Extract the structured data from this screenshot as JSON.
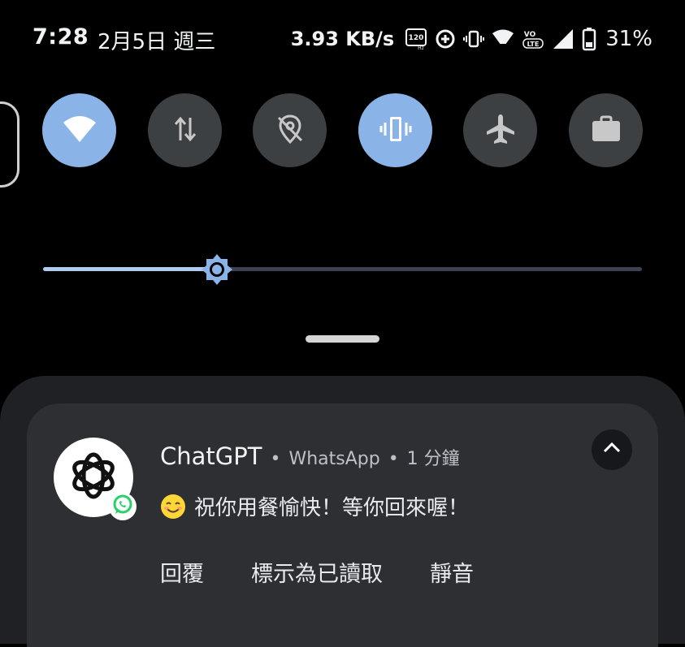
{
  "status_bar": {
    "time": "7:28",
    "date": "2月5日 週三",
    "network_speed": "3.93 KB/s",
    "battery_percent": "31%",
    "icons": [
      "120hz-icon",
      "data-saver-icon",
      "vibrate-icon",
      "wifi-signal-icon",
      "volte-icon",
      "cell-signal-icon",
      "battery-icon"
    ],
    "hz_label": "120",
    "hz_sub": "Hz",
    "volte_top": "VO",
    "volte_bottom": "LTE"
  },
  "quick_tiles": [
    {
      "name": "wifi",
      "icon": "wifi-icon",
      "active": true
    },
    {
      "name": "mobile-data",
      "icon": "data-arrows-icon",
      "active": false
    },
    {
      "name": "location",
      "icon": "location-off-icon",
      "active": false
    },
    {
      "name": "vibrate",
      "icon": "vibrate-icon",
      "active": true
    },
    {
      "name": "airplane-mode",
      "icon": "airplane-icon",
      "active": false
    },
    {
      "name": "work-profile",
      "icon": "briefcase-icon",
      "active": false
    }
  ],
  "brightness": {
    "level": 0.29,
    "icon": "brightness-icon"
  },
  "notification": {
    "title": "ChatGPT",
    "separator": "•",
    "app": "WhatsApp",
    "time": "1 分鐘",
    "message": "祝你用餐愉快！等你回來喔！",
    "avatar_icon": "openai-logo-icon",
    "badge_icon": "whatsapp-icon",
    "actions": [
      "回覆",
      "標示為已讀取",
      "靜音"
    ]
  },
  "colors": {
    "tile_active": "#8ab4e8",
    "tile_inactive": "#3c4043",
    "whatsapp_green": "#25d366",
    "card": "#2d2f33"
  }
}
